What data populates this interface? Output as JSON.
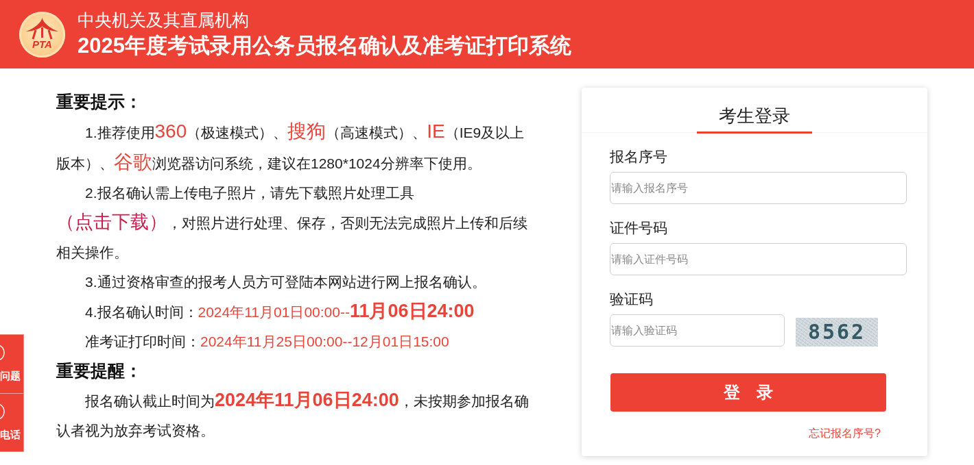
{
  "header": {
    "logo_text": "PTA",
    "subtitle": "中央机关及其直属机构",
    "title": "2025年度考试录用公务员报名确认及准考证打印系统"
  },
  "notice": [
    {
      "kind": "heading",
      "text": "重要提示："
    },
    {
      "kind": "paragraph",
      "segments": [
        {
          "kind": "text",
          "text": "1.推荐使用"
        },
        {
          "kind": "browser",
          "text": "360"
        },
        {
          "kind": "text",
          "text": "（极速模式）、"
        },
        {
          "kind": "browser",
          "text": "搜狗"
        },
        {
          "kind": "text",
          "text": "（高速模式）、"
        },
        {
          "kind": "browser",
          "text": "IE"
        },
        {
          "kind": "text",
          "text": "（IE9及以上版本）、"
        },
        {
          "kind": "browser",
          "text": "谷歌"
        },
        {
          "kind": "text",
          "text": "浏览器访问系统，建议在1280*1024分辨率下使用。"
        }
      ]
    },
    {
      "kind": "paragraph",
      "segments": [
        {
          "kind": "text",
          "text": "2.报名确认需上传电子照片，请先下载照片处理工具"
        },
        {
          "kind": "link",
          "text": "（点击下载）"
        },
        {
          "kind": "text",
          "text": "，对照片进行处理、保存，否则无法完成照片上传和后续相关操作。"
        }
      ]
    },
    {
      "kind": "paragraph",
      "segments": [
        {
          "kind": "text",
          "text": "3.通过资格审查的报考人员方可登陆本网站进行网上报名确认。"
        }
      ]
    },
    {
      "kind": "paragraph",
      "segments": [
        {
          "kind": "text",
          "text": "4.报名确认时间："
        },
        {
          "kind": "date",
          "text": "2024年11月01日00:00--"
        },
        {
          "kind": "date_strong",
          "text": "11月06日24:00"
        }
      ]
    },
    {
      "kind": "paragraph",
      "segments": [
        {
          "kind": "text",
          "text": "准考证打印时间："
        },
        {
          "kind": "date",
          "text": "2024年11月25日00:00--12月01日15:00"
        }
      ]
    },
    {
      "kind": "heading",
      "text": "重要提醒："
    },
    {
      "kind": "paragraph",
      "segments": [
        {
          "kind": "text",
          "text": "报名确认截止时间为"
        },
        {
          "kind": "date_strong",
          "text": "2024年11月06日24:00"
        },
        {
          "kind": "text",
          "text": "，未按期参加报名确认者视为放弃考试资格。"
        }
      ]
    }
  ],
  "login": {
    "title": "考生登录",
    "fields": [
      {
        "kind": "text",
        "label": "报名序号",
        "placeholder": "请输入报名序号"
      },
      {
        "kind": "text",
        "label": "证件号码",
        "placeholder": "请输入证件号码"
      },
      {
        "kind": "captcha",
        "label": "验证码",
        "placeholder": "请输入验证码",
        "captcha": "8562"
      }
    ],
    "submit": "登　录",
    "forgot_link": "忘记报名序号?"
  },
  "side_tabs": [
    {
      "label": "问题"
    },
    {
      "label": "电话"
    }
  ]
}
